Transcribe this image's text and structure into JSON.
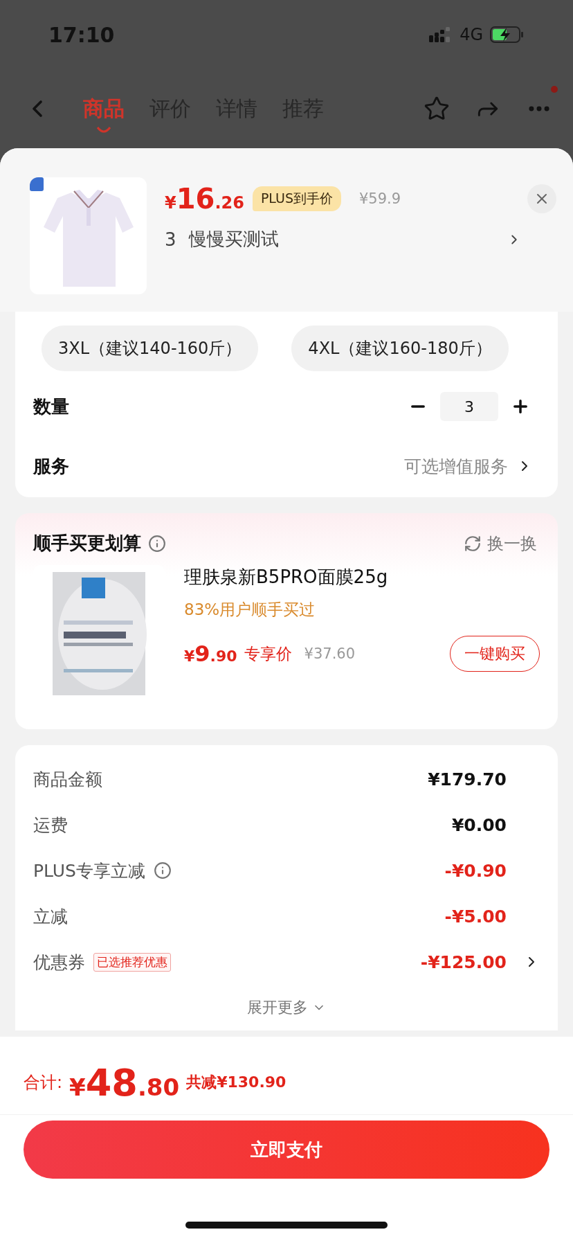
{
  "status_bar": {
    "time": "17:10",
    "network": "4G"
  },
  "nav": {
    "tabs": [
      {
        "label": "商品",
        "selected": true
      },
      {
        "label": "评价",
        "selected": false
      },
      {
        "label": "详情",
        "selected": false
      },
      {
        "label": "推荐",
        "selected": false
      }
    ],
    "notification_dot": true
  },
  "sheet_header": {
    "price": {
      "currency": "¥",
      "integer": "16",
      "decimal": ".26"
    },
    "price_tag": "PLUS到手价",
    "original_price": "¥59.9",
    "spec_index": "3",
    "spec_name": "慢慢买测试"
  },
  "size_options": [
    {
      "label": "3XL（建议140-160斤）",
      "selected": false
    },
    {
      "label": "4XL（建议160-180斤）",
      "selected": false
    }
  ],
  "quantity": {
    "label": "数量",
    "value": "3"
  },
  "service": {
    "label": "服务",
    "value": "可选增值服务"
  },
  "recommendation": {
    "title": "顺手买更划算",
    "refresh": "换一换",
    "product": {
      "name": "理肤泉新B5PRO面膜25g",
      "buyers": "83%用户顺手买过",
      "price": {
        "currency": "¥",
        "integer": "9",
        "decimal": ".90"
      },
      "price_tag": "专享价",
      "original_price": "¥37.60",
      "buy_button": "一键购买"
    }
  },
  "summary": {
    "rows": [
      {
        "label": "商品金额",
        "value": "¥179.70",
        "kind": "plain",
        "info": false,
        "link": false
      },
      {
        "label": "运费",
        "value": "¥0.00",
        "kind": "plain",
        "info": false,
        "link": false
      },
      {
        "label": "PLUS专享立减",
        "value": "-¥0.90",
        "kind": "discount",
        "info": true,
        "link": false
      },
      {
        "label": "立减",
        "value": "-¥5.00",
        "kind": "discount",
        "info": false,
        "link": false
      },
      {
        "label": "优惠券",
        "tag": "已选推荐优惠",
        "value": "-¥125.00",
        "kind": "discount",
        "info": false,
        "link": true
      }
    ],
    "expand": "展开更多"
  },
  "footer": {
    "total_label": "合计:",
    "total": {
      "currency": "¥",
      "integer": "48",
      "decimal": ".80"
    },
    "saved": "共减¥130.90",
    "pay_button": "立即支付"
  }
}
